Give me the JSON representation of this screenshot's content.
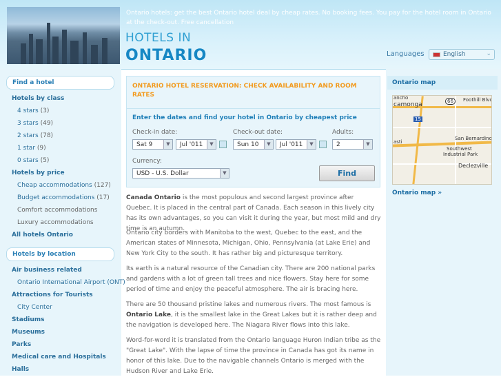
{
  "header": {
    "tagline": "Ontario hotels: get the best Ontario hotel deal by cheap rates. No booking fees. You pay for the hotel room in Ontario at the check-out. Free cancellation",
    "brand_line1": "HOTELS IN",
    "brand_line2": "ONTARIO",
    "languages_label": "Languages",
    "language_selected": "English"
  },
  "sidebar": {
    "find_hotel": "Find a hotel",
    "hotels_by_class": "Hotels by class",
    "classes": [
      {
        "label": "4 stars",
        "count": "(3)"
      },
      {
        "label": "3 stars",
        "count": "(49)"
      },
      {
        "label": "2 stars",
        "count": "(78)"
      },
      {
        "label": "1 star",
        "count": "(9)"
      },
      {
        "label": "0 stars",
        "count": "(5)"
      }
    ],
    "hotels_by_price": "Hotels by price",
    "prices": [
      {
        "label": "Cheap accommodations",
        "count": "(127)"
      },
      {
        "label": "Budget accommodations",
        "count": "(17)"
      },
      {
        "label": "Comfort accommodations",
        "count": ""
      },
      {
        "label": "Luxury accommodations",
        "count": ""
      }
    ],
    "all_hotels": "All hotels Ontario",
    "hotels_by_location": "Hotels by location",
    "air_business": "Air business related",
    "airport": "Ontario International Airport (ONT)",
    "attractions": "Attractions for Tourists",
    "city_center": "City Center",
    "stadiums": "Stadiums",
    "museums": "Museums",
    "parks": "Parks",
    "medical": "Medical care and Hospitals",
    "halls": "Halls"
  },
  "search": {
    "title": "ONTARIO HOTEL RESERVATION: CHECK AVAILABILITY AND ROOM RATES",
    "subtitle": "Enter the dates and find your hotel in Ontario by cheapest price",
    "checkin_label": "Check-in date:",
    "checkin_day": "Sat 9",
    "checkin_month": "Jul '011",
    "checkout_label": "Check-out date:",
    "checkout_day": "Sun 10",
    "checkout_month": "Jul '011",
    "adults_label": "Adults:",
    "adults_value": "2",
    "currency_label": "Currency:",
    "currency_value": "USD - U.S. Dollar",
    "find_button": "Find"
  },
  "content": {
    "p1_bold": "Canada Ontario",
    "p1": " is the most populous and second largest province after Quebec. It is placed in the central part of Canada. Each season in this lively city has its own advantages, so you can visit it during the year, but most mild and dry time is an autumn.",
    "p2": "Ontario city borders with Manitoba to the west, Quebec to the east, and the American states of Minnesota, Michigan, Ohio, Pennsylvania (at Lake Erie) and New York City to the south. It has rather big and picturesque territory.",
    "p3": "Its earth is a natural resource of the Canadian city. There are 200 national parks and gardens with a lot of green tall trees and nice flowers. Stay here for some period of time and enjoy the peaceful atmosphere. The air is bracing here.",
    "p4_a": "There are 50 thousand pristine lakes and numerous rivers. The most famous is ",
    "p4_bold": "Ontario Lake",
    "p4_b": ", it is the smallest lake in the Great Lakes but it is rather deep and the navigation is developed here. The Niagara River flows into this lake.",
    "p5": "Word-for-word it is translated from the Ontario language Huron Indian tribe as the \"Great Lake\". With the lapse of time the province in Canada has got its name in honor of this lake. Due to the navigable channels Ontario is merged with the Hudson River and Lake Erie."
  },
  "map": {
    "title": "Ontario map",
    "link": "Ontario map »",
    "labels": [
      "ancho",
      "camonga",
      "66",
      "Foothill Blvd",
      "15",
      "asti",
      "San Bernardino Fwy",
      "Southwest",
      "Industrial Park",
      "Declezville"
    ]
  },
  "colors": {
    "accent_orange": "#f29a1e",
    "link_blue": "#2b6f9b",
    "header_bg": "#bfe6f6"
  }
}
